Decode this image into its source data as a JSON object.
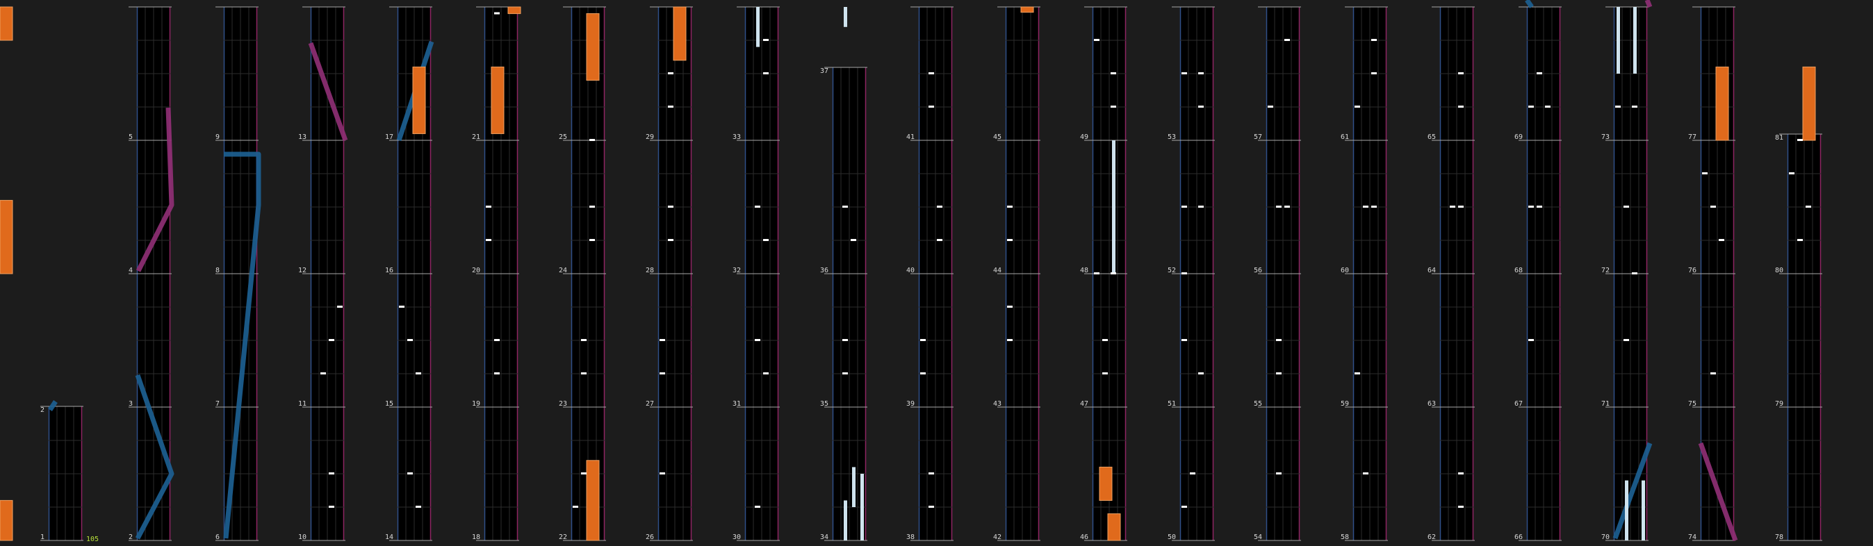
{
  "screen": {
    "view": "rhythm-chart-preview",
    "combo_label": "105"
  },
  "colors": {
    "background": "#1c1c1c",
    "lane": "#000000",
    "lane_edge_left": "#2f4f88",
    "lane_edge_right": "#8e2462",
    "measure_line": "#a9a9a9",
    "subdivision": "#2c2c2c",
    "tap_note": "#ffffff",
    "hold_note": "#cfe3ee",
    "chain_note": "#e06a1c",
    "slide_left": "#1c5f91",
    "slide_right": "#8e2f74",
    "combo_text": "#b9e23a"
  },
  "icons": {
    "tap": "tap-note-icon",
    "hold": "hold-note-icon",
    "chain": "chain-note-icon",
    "slide": "slide-arc-icon"
  },
  "chart_data": {
    "type": "table",
    "measures": [
      "1",
      "2",
      "3",
      "4",
      "5",
      "6",
      "7",
      "8",
      "9",
      "10",
      "11",
      "12",
      "13",
      "14",
      "15",
      "16",
      "17",
      "18",
      "19",
      "20",
      "21",
      "22",
      "23",
      "24",
      "25",
      "26",
      "27",
      "28",
      "29",
      "30",
      "31",
      "32",
      "33",
      "34",
      "35",
      "36",
      "37",
      "38",
      "39",
      "40",
      "41",
      "42",
      "43",
      "44",
      "45",
      "46",
      "47",
      "48",
      "49",
      "50",
      "51",
      "52",
      "53",
      "54",
      "55",
      "56",
      "57",
      "58",
      "59",
      "60",
      "61",
      "62",
      "63",
      "64",
      "65",
      "66",
      "67",
      "68",
      "69",
      "70",
      "71",
      "72",
      "73",
      "74",
      "75",
      "76",
      "77",
      "78",
      "79",
      "80",
      "81"
    ],
    "column_bottom_measures": [
      "1",
      "2",
      "6",
      "10",
      "14",
      "18",
      "22",
      "26",
      "30",
      "34",
      "38",
      "42",
      "46",
      "50",
      "54",
      "58",
      "62",
      "66",
      "70",
      "74",
      "78"
    ],
    "combo": "105"
  }
}
